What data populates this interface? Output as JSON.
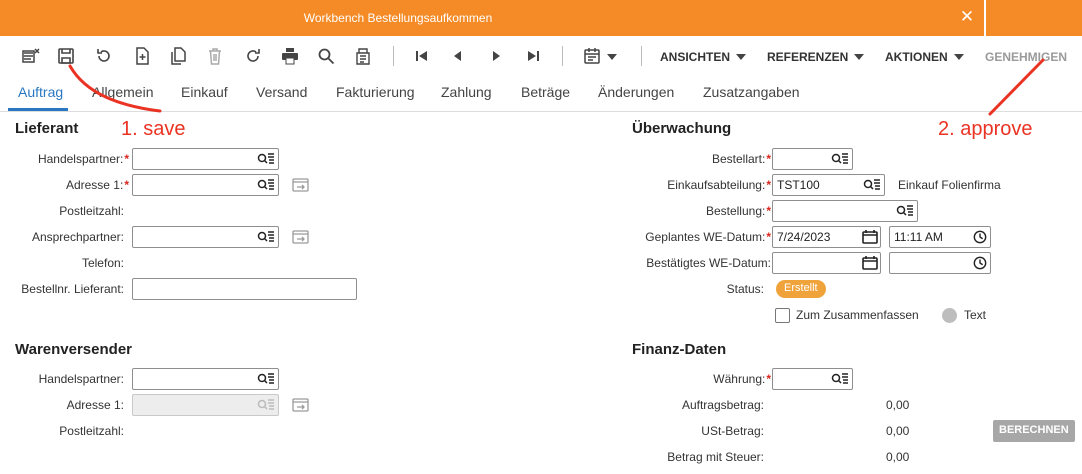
{
  "window": {
    "title": "Workbench Bestellungsaufkommen",
    "close_glyph": "✕"
  },
  "toolbar": {
    "menus": {
      "ansichten": "ANSICHTEN",
      "referenzen": "REFERENZEN",
      "aktionen": "AKTIONEN",
      "genehmigen": "GENEHMIGEN"
    },
    "icons": [
      "new-cancel-icon",
      "save-icon",
      "undo-icon",
      "new-record-icon",
      "copy-icon",
      "delete-icon",
      "refresh-icon",
      "print-icon",
      "search-icon",
      "document-list-icon",
      "first-record-icon",
      "previous-record-icon",
      "next-record-icon",
      "last-record-icon",
      "calendar-icon"
    ]
  },
  "tabs": [
    "Auftrag",
    "Allgemein",
    "Einkauf",
    "Versand",
    "Fakturierung",
    "Zahlung",
    "Beträge",
    "Änderungen",
    "Zusatzangaben"
  ],
  "lieferant": {
    "title": "Lieferant",
    "handelspartner_label": "Handelspartner:",
    "adresse_label": "Adresse 1:",
    "postleitzahl_label": "Postleitzahl:",
    "ansprechpartner_label": "Ansprechpartner:",
    "telefon_label": "Telefon:",
    "bestellnr_label": "Bestellnr. Lieferant:"
  },
  "ueberwachung": {
    "title": "Überwachung",
    "bestellart_label": "Bestellart:",
    "einkaufsabteilung_label": "Einkaufsabteilung:",
    "einkaufsabteilung_value": "TST100",
    "einkaufsabteilung_desc": "Einkauf Folienfirma",
    "bestellung_label": "Bestellung:",
    "geplantes_label": "Geplantes WE-Datum:",
    "geplantes_date": "7/24/2023",
    "geplantes_time": "11:11 AM",
    "bestaetigtes_label": "Bestätigtes WE-Datum:",
    "status_label": "Status:",
    "status_value": "Erstellt",
    "zusammenfassen_label": "Zum Zusammenfassen",
    "text_label": "Text"
  },
  "warenversender": {
    "title": "Warenversender",
    "handelspartner_label": "Handelspartner:",
    "adresse_label": "Adresse 1:",
    "postleitzahl_label": "Postleitzahl:"
  },
  "finanz": {
    "title": "Finanz-Daten",
    "waehrung_label": "Währung:",
    "auftragsbetrag_label": "Auftragsbetrag:",
    "auftragsbetrag_value": "0,00",
    "ust_label": "USt-Betrag:",
    "ust_value": "0,00",
    "steuer_label": "Betrag mit Steuer:",
    "steuer_value": "0,00",
    "berechnen_label": "BERECHNEN"
  },
  "annotations": {
    "step1": "1. save",
    "step2": "2. approve"
  },
  "colors": {
    "brand": "#f58b27",
    "accent": "#2a78c2",
    "status": "#f0a33a",
    "annotation": "#ea3323",
    "required": "#d9261c"
  }
}
